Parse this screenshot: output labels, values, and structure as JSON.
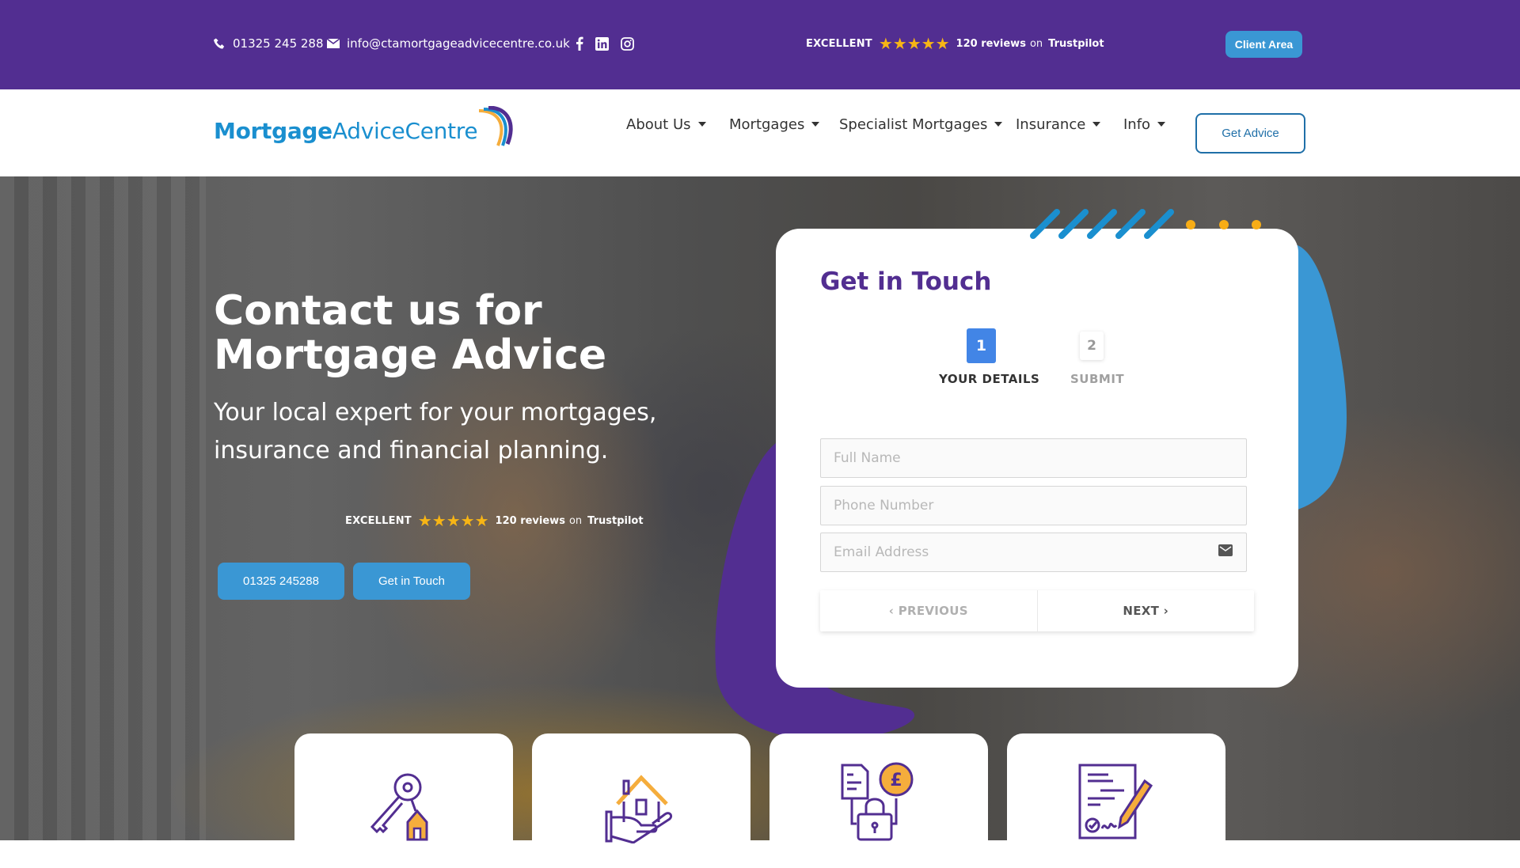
{
  "topbar": {
    "phone": "01325 245 288",
    "email": "info@ctamortgageadvicecentre.co.uk",
    "social": [
      "facebook-icon",
      "linkedin-icon",
      "instagram-icon"
    ],
    "trustpilot": {
      "rating_word": "EXCELLENT",
      "stars": 5,
      "reviews": "120 reviews",
      "on": "on",
      "brand": "Trustpilot"
    },
    "client_area": "Client Area"
  },
  "header": {
    "logo_bold": "Mortgage",
    "logo_regular": "AdviceCentre",
    "nav": [
      {
        "label": "About Us"
      },
      {
        "label": "Mortgages"
      },
      {
        "label": "Specialist Mortgages"
      },
      {
        "label": "Insurance"
      },
      {
        "label": "Info"
      }
    ],
    "cta": "Get Advice"
  },
  "hero": {
    "title": "Contact us for Mortgage Advice",
    "subtitle": "Your local expert for your mortgages, insurance and financial planning.",
    "trustpilot": {
      "rating_word": "EXCELLENT",
      "stars": 5,
      "reviews": "120 reviews",
      "on": "on",
      "brand": "Trustpilot"
    },
    "buttons": {
      "phone": "01325 245288",
      "contact": "Get in Touch"
    }
  },
  "form": {
    "title": "Get in Touch",
    "steps": [
      {
        "number": "1",
        "label": "YOUR DETAILS",
        "active": true
      },
      {
        "number": "2",
        "label": "SUBMIT",
        "active": false
      }
    ],
    "fields": {
      "full_name": {
        "placeholder": "Full Name",
        "value": ""
      },
      "phone": {
        "placeholder": "Phone Number",
        "value": ""
      },
      "email": {
        "placeholder": "Email Address",
        "value": ""
      }
    },
    "prev": "‹ PREVIOUS",
    "next": "NEXT ›"
  },
  "services": [
    {
      "icon": "keys-house-icon"
    },
    {
      "icon": "house-in-hand-icon"
    },
    {
      "icon": "document-pound-lock-icon"
    },
    {
      "icon": "signed-contract-icon"
    }
  ],
  "colors": {
    "brand_purple": "#522e91",
    "brand_blue": "#3a97d4",
    "star_yellow": "#f7b515",
    "step_active": "#4285e6",
    "accent_orange": "#f5ad3c"
  }
}
